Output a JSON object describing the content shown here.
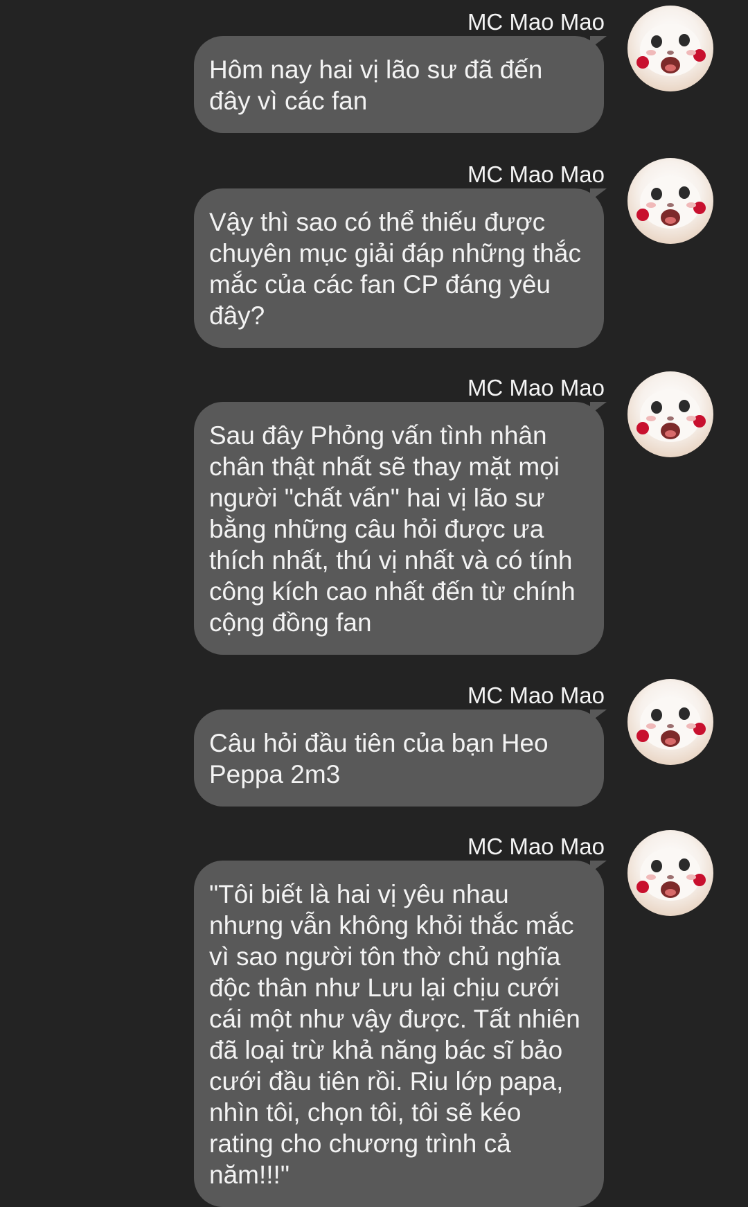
{
  "messages": [
    {
      "sender": "MC Mao Mao",
      "text": "Hôm nay hai vị lão sư đã đến đây vì các fan"
    },
    {
      "sender": "MC Mao Mao",
      "text": "Vậy thì sao có thể thiếu được chuyên mục giải đáp những thắc mắc của các fan CP đáng yêu đây?"
    },
    {
      "sender": "MC Mao Mao",
      "text": "Sau đây Phỏng vấn tình nhân chân thật nhất sẽ thay mặt mọi người \"chất vấn\" hai vị lão sư bằng những câu hỏi được ưa thích nhất, thú vị nhất và có tính công kích cao nhất đến từ chính cộng đồng fan"
    },
    {
      "sender": "MC Mao Mao",
      "text": "Câu hỏi đầu tiên của bạn Heo Peppa 2m3"
    },
    {
      "sender": "MC Mao Mao",
      "text": "\"Tôi biết là hai vị yêu nhau nhưng vẫn không khỏi thắc mắc vì sao người tôn thờ chủ nghĩa độc thân như Lưu lại chịu cưới cái một như vậy được. Tất nhiên đã loại trừ khả năng bác sĩ bảo cưới đầu tiên rồi. Riu lớp papa, nhìn tôi, chọn tôi, tôi sẽ kéo rating cho chương trình cả năm!!!\""
    }
  ],
  "avatar_icon": "cat-with-roses-icon",
  "colors": {
    "background": "#232323",
    "bubble": "#595959",
    "text": "#f3f3f3"
  }
}
